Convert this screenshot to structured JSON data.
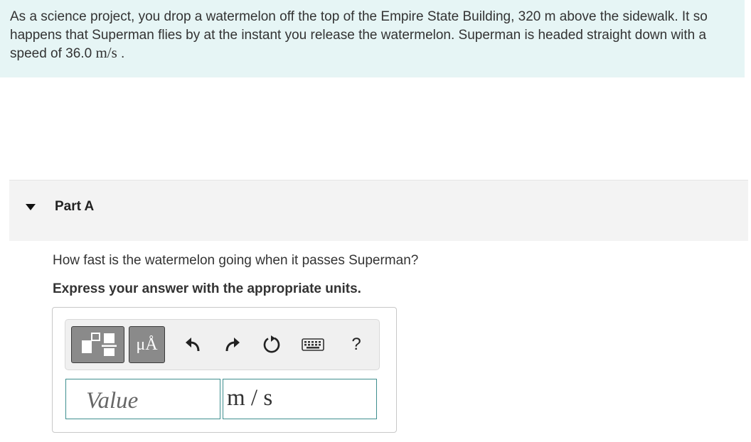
{
  "problem": {
    "text_1": "As a science project, you drop a watermelon off the top of the Empire State Building, 320 m above the sidewalk. It so happens that Superman flies by at the instant you release the watermelon. Superman is headed straight down with a speed of 36.0 ",
    "speed_unit": "m/s",
    "text_2": " ."
  },
  "part": {
    "title": "Part A",
    "question": "How fast is the watermelon going when it passes Superman?",
    "instruction": "Express your answer with the appropriate units."
  },
  "toolbar": {
    "templates_icon": "templates-icon",
    "units_label": "μÅ",
    "undo_icon": "undo-icon",
    "redo_icon": "redo-icon",
    "reset_icon": "reset-icon",
    "keyboard_icon": "keyboard-icon",
    "help_label": "?"
  },
  "answer": {
    "value_placeholder": "Value",
    "units": "m / s"
  },
  "colors": {
    "problem_bg": "#e6f5f5",
    "part_header_bg": "#f3f3f3",
    "input_border": "#3f8f8f",
    "toolbar_button": "#8a8a8a"
  }
}
